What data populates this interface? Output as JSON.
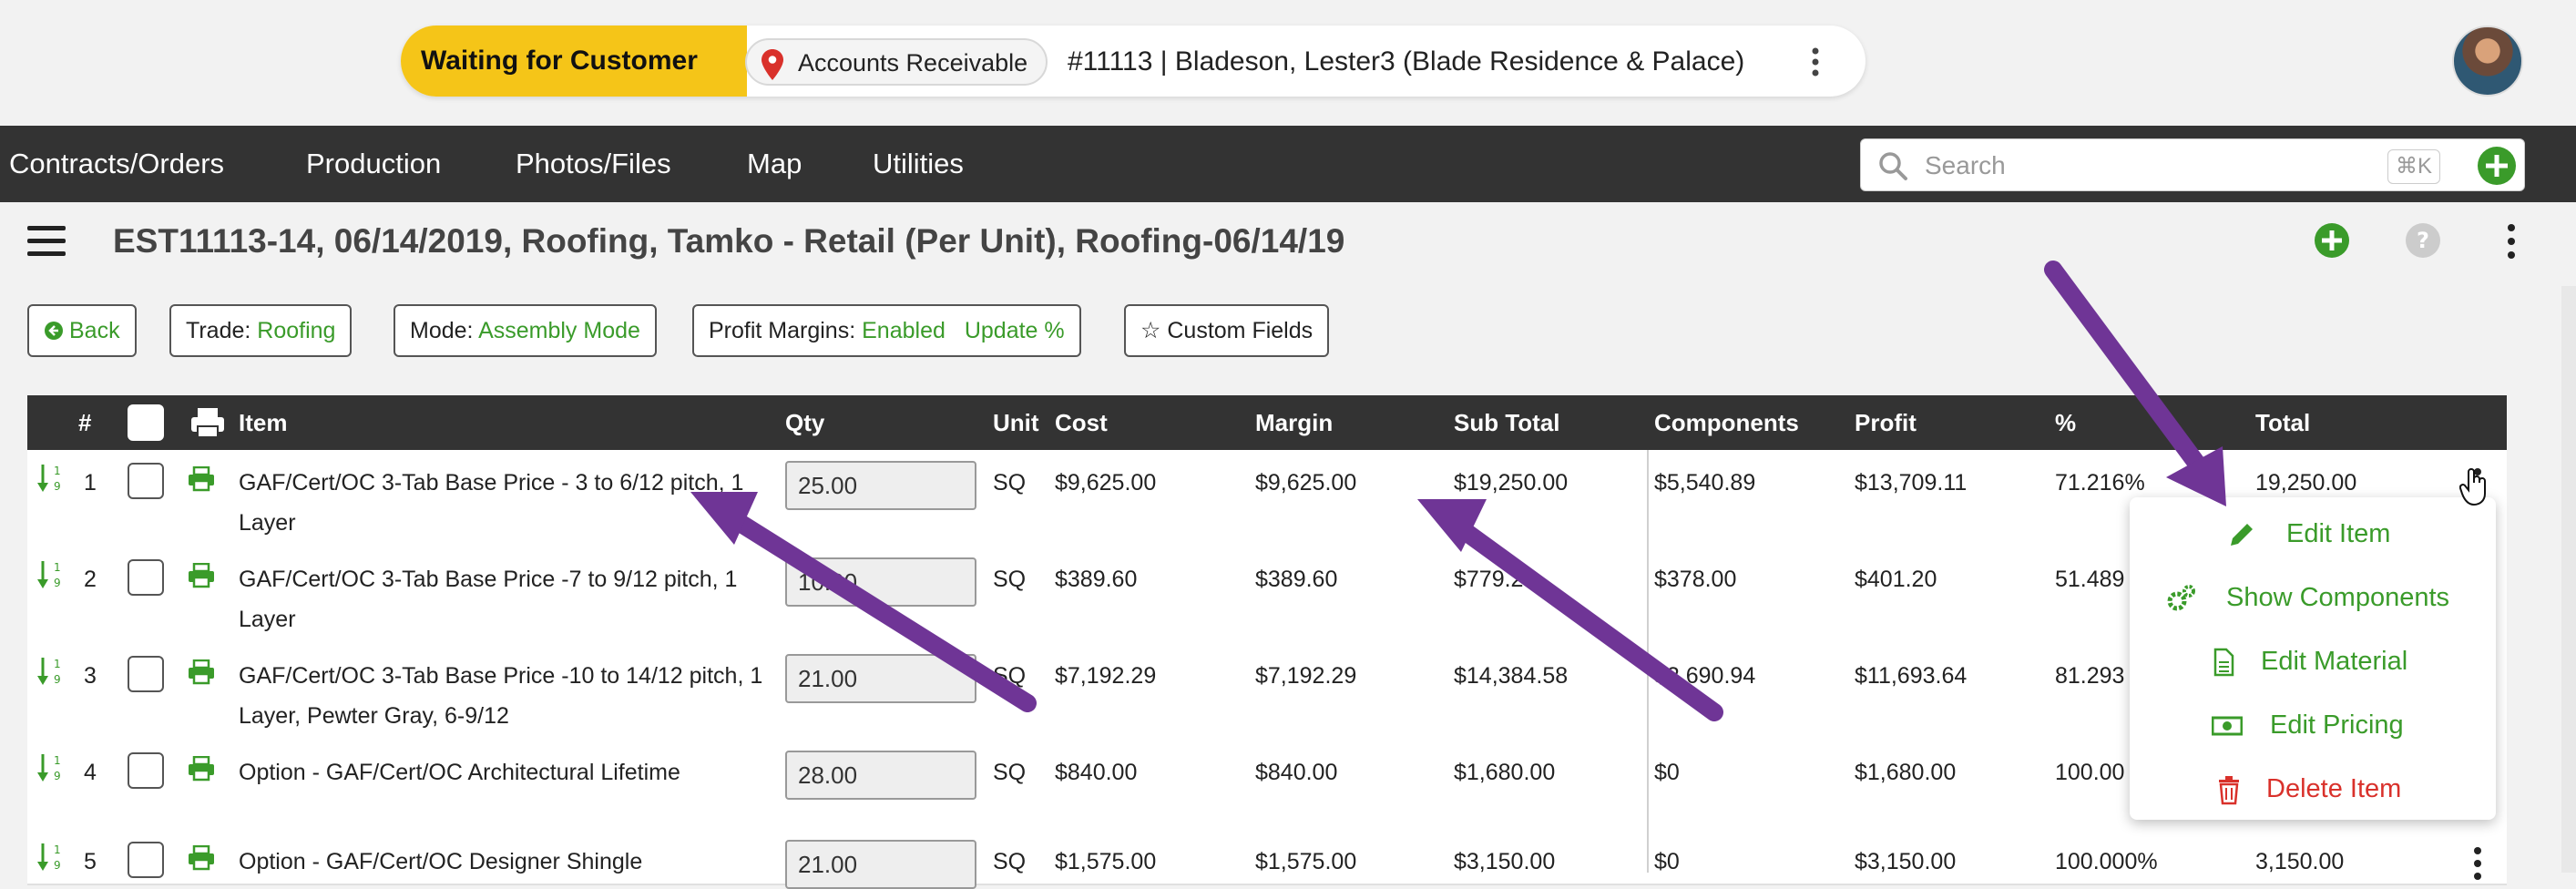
{
  "status": {
    "label": "Waiting for Customer",
    "department": "Accounts Receivable",
    "job": "#11113 | Bladeson, Lester3 (Blade Residence & Palace)"
  },
  "nav": {
    "items": [
      "Contracts/Orders",
      "Production",
      "Photos/Files",
      "Map",
      "Utilities"
    ]
  },
  "search": {
    "placeholder": "Search",
    "shortcut": "⌘K"
  },
  "page": {
    "title": "EST11113-14, 06/14/2019, Roofing, Tamko - Retail (Per Unit), Roofing-06/14/19"
  },
  "toolbar": {
    "back": "Back",
    "trade_label": "Trade:",
    "trade_value": "Roofing",
    "mode_label": "Mode:",
    "mode_value": "Assembly Mode",
    "profit_label": "Profit Margins:",
    "profit_value": "Enabled",
    "profit_action": "Update %",
    "custom": "Custom Fields"
  },
  "table": {
    "headers": {
      "num": "#",
      "item": "Item",
      "qty": "Qty",
      "unit": "Unit",
      "cost": "Cost",
      "margin": "Margin",
      "subtotal": "Sub Total",
      "components": "Components",
      "profit": "Profit",
      "pct": "%",
      "total": "Total"
    },
    "rows": [
      {
        "num": "1",
        "item": "GAF/Cert/OC 3-Tab Base Price - 3 to 6/12 pitch, 1 Layer",
        "qty": "25.00",
        "unit": "SQ",
        "cost": "$9,625.00",
        "margin": "$9,625.00",
        "subtotal": "$19,250.00",
        "components": "$5,540.89",
        "profit": "$13,709.11",
        "pct": "71.216%",
        "total": "19,250.00"
      },
      {
        "num": "2",
        "item": "GAF/Cert/OC 3-Tab Base Price -7 to 9/12 pitch, 1 Layer",
        "qty": "10.00",
        "unit": "SQ",
        "cost": "$389.60",
        "margin": "$389.60",
        "subtotal": "$779.20",
        "components": "$378.00",
        "profit": "$401.20",
        "pct": "51.489",
        "total": ""
      },
      {
        "num": "3",
        "item": "GAF/Cert/OC 3-Tab Base Price -10 to 14/12 pitch, 1 Layer, Pewter Gray, 6-9/12",
        "qty": "21.00",
        "unit": "SQ",
        "cost": "$7,192.29",
        "margin": "$7,192.29",
        "subtotal": "$14,384.58",
        "components": "$2,690.94",
        "profit": "$11,693.64",
        "pct": "81.293",
        "total": ""
      },
      {
        "num": "4",
        "item": "Option - GAF/Cert/OC Architectural Lifetime",
        "qty": "28.00",
        "unit": "SQ",
        "cost": "$840.00",
        "margin": "$840.00",
        "subtotal": "$1,680.00",
        "components": "$0",
        "profit": "$1,680.00",
        "pct": "100.00",
        "total": ""
      },
      {
        "num": "5",
        "item": "Option - GAF/Cert/OC Designer Shingle",
        "qty": "21.00",
        "unit": "SQ",
        "cost": "$1,575.00",
        "margin": "$1,575.00",
        "subtotal": "$3,150.00",
        "components": "$0",
        "profit": "$3,150.00",
        "pct": "100.000%",
        "total": "3,150.00"
      }
    ]
  },
  "dropdown": {
    "items": [
      "Edit Item",
      "Show Components",
      "Edit Material",
      "Edit Pricing",
      "Delete Item"
    ]
  },
  "colors": {
    "accent_green": "#3a9b2a",
    "status_yellow": "#f5c518",
    "nav_bg": "#333333",
    "danger_red": "#d9312b",
    "arrow_purple": "#6f3596"
  }
}
